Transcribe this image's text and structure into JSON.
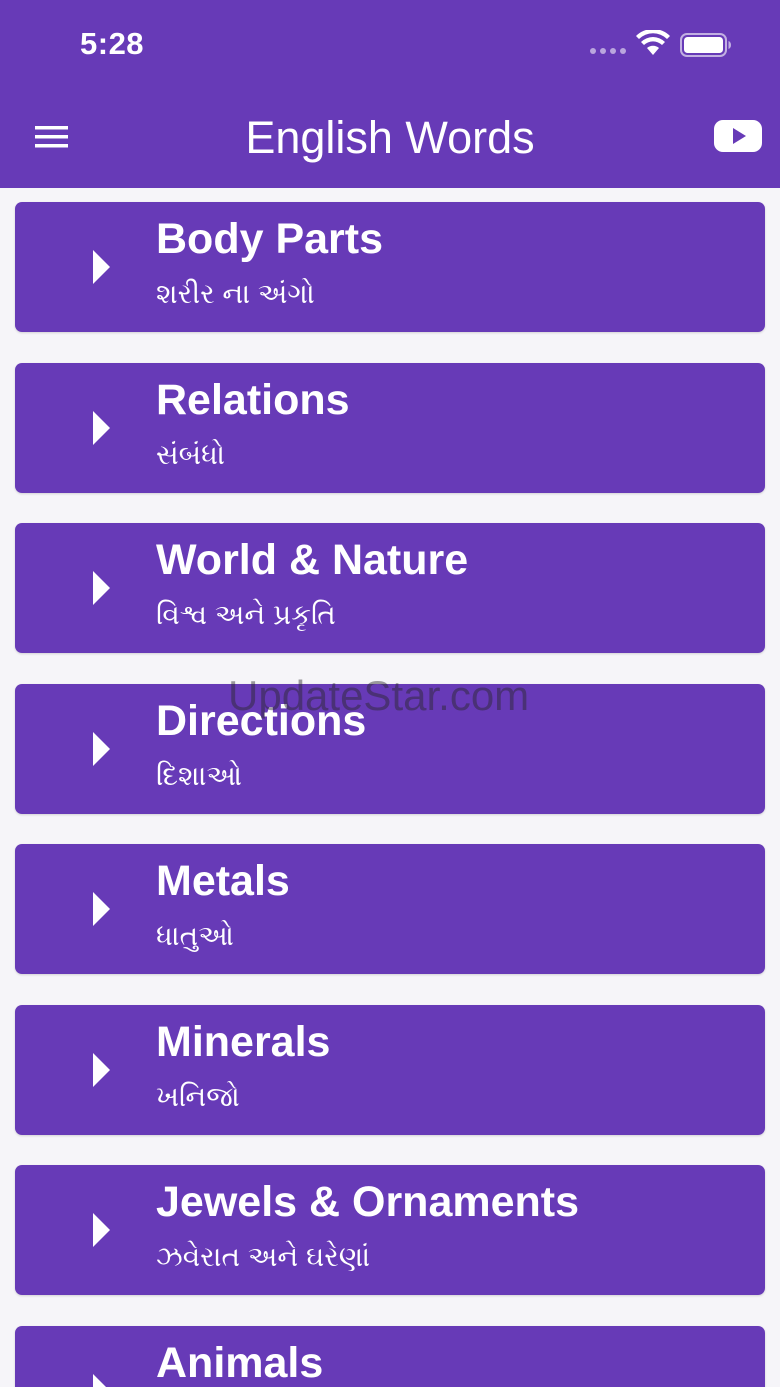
{
  "status_bar": {
    "time": "5:28"
  },
  "header": {
    "title": "English Words"
  },
  "categories": [
    {
      "english": "Body Parts",
      "gujarati": "શરીર ના અંગો"
    },
    {
      "english": "Relations",
      "gujarati": "સંબંધો"
    },
    {
      "english": "World & Nature",
      "gujarati": "વિશ્વ અને પ્રકૃતિ"
    },
    {
      "english": "Directions",
      "gujarati": "દિશાઓ"
    },
    {
      "english": "Metals",
      "gujarati": "ધાતુઓ"
    },
    {
      "english": "Minerals",
      "gujarati": "ખનિજો"
    },
    {
      "english": "Jewels & Ornaments",
      "gujarati": "ઝવેરાત અને ઘરેણાં"
    },
    {
      "english": "Animals",
      "gujarati": ""
    }
  ],
  "watermark": "UpdateStar.com",
  "colors": {
    "primary": "#673ab7",
    "background": "#f6f5f9",
    "text": "#ffffff"
  },
  "icons": {
    "menu": "hamburger-menu-icon",
    "video": "youtube-icon",
    "expand": "caret-right-icon"
  }
}
